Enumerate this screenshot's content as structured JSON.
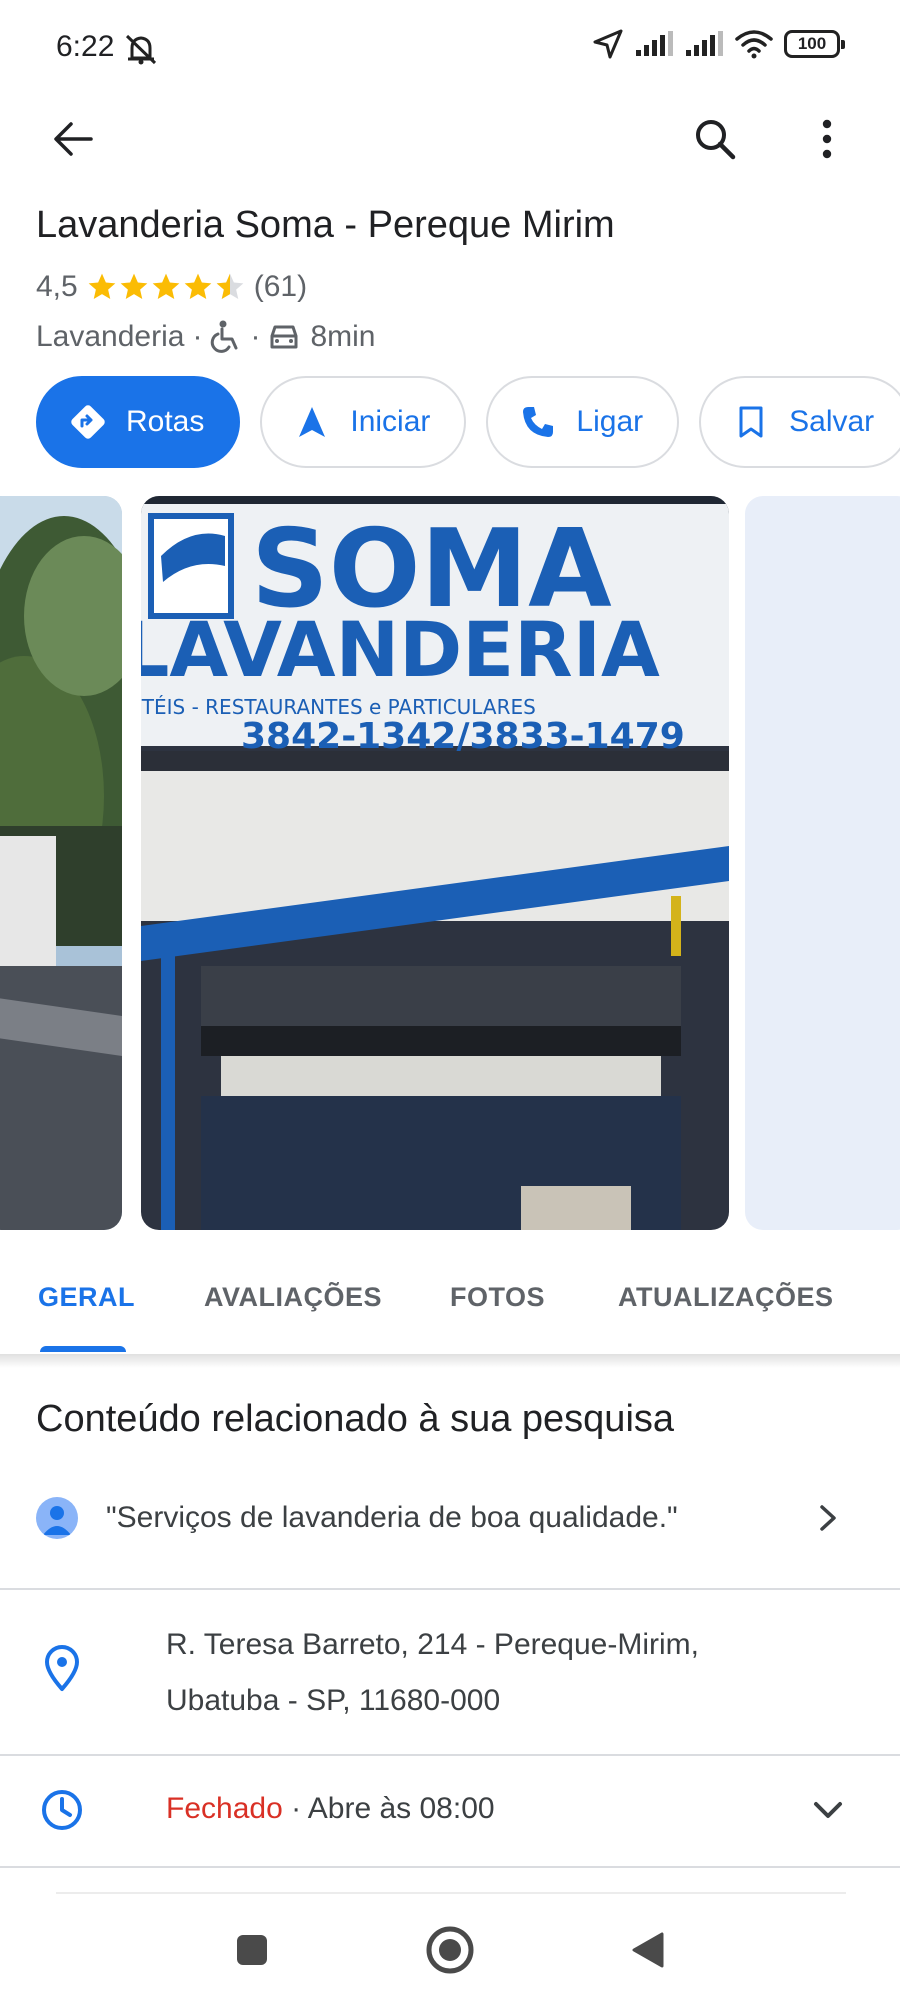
{
  "status_bar": {
    "time": "6:22",
    "battery": "100",
    "icons": [
      "mute-icon",
      "location-arrow-icon",
      "signal-icon",
      "signal-icon",
      "wifi-icon",
      "battery-icon"
    ]
  },
  "app_bar": {
    "icons": [
      "back-arrow-icon",
      "search-icon",
      "more-vert-icon"
    ]
  },
  "place": {
    "title": "Lavanderia Soma - Pereque Mirim",
    "rating": "4,5",
    "stars": 4.5,
    "review_count": "(61)",
    "category": "Lavanderia",
    "separator": "·",
    "travel_time": "8min"
  },
  "actions": [
    {
      "label": "Rotas",
      "icon": "directions-icon"
    },
    {
      "label": "Iniciar",
      "icon": "navigation-icon"
    },
    {
      "label": "Ligar",
      "icon": "phone-icon"
    },
    {
      "label": "Salvar",
      "icon": "bookmark-icon"
    }
  ],
  "photo_sign": {
    "line1": "SOMA",
    "line2": "LAVANDERIA",
    "line3": "HOTÉIS - RESTAURANTES e PARTICULARES",
    "line4": "3842-1342/3833-1479"
  },
  "tabs": [
    {
      "label": "GERAL",
      "active": true
    },
    {
      "label": "AVALIAÇÕES",
      "active": false
    },
    {
      "label": "FOTOS",
      "active": false
    },
    {
      "label": "ATUALIZAÇÕES",
      "active": false
    }
  ],
  "related": {
    "title": "Conteúdo relacionado à sua pesquisa",
    "quote": "\"Serviços de lavanderia de boa qualidade.\""
  },
  "address": {
    "line1": "R. Teresa Barreto, 214 - Pereque-Mirim,",
    "line2": "Ubatuba - SP, 11680-000"
  },
  "hours": {
    "status": "Fechado",
    "separator": " · ",
    "detail": "Abre às 08:00"
  },
  "colors": {
    "accent": "#1a73e8",
    "star": "#fbbc04",
    "closed": "#d93025"
  }
}
